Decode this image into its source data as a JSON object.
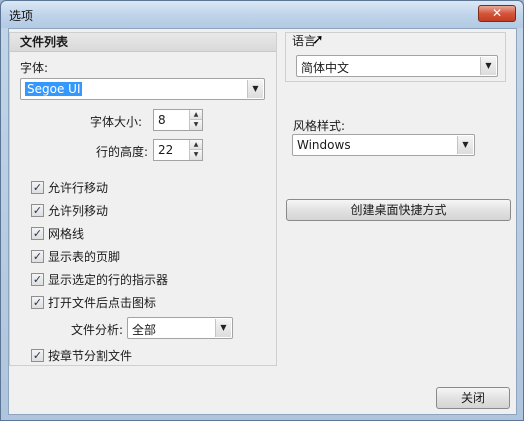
{
  "window": {
    "title": "选项",
    "close_glyph": "✕"
  },
  "file_list": {
    "header": "文件列表",
    "font_label": "字体:",
    "font_value": "Segoe UI",
    "font_size_label": "字体大小:",
    "font_size_value": "8",
    "row_height_label": "行的高度:",
    "row_height_value": "22",
    "checkboxes": [
      {
        "label": "允许行移动",
        "checked": true
      },
      {
        "label": "允许列移动",
        "checked": true
      },
      {
        "label": "网格线",
        "checked": true
      },
      {
        "label": "显示表的页脚",
        "checked": true
      },
      {
        "label": "显示选定的行的指示器",
        "checked": true
      },
      {
        "label": "打开文件后点击图标",
        "checked": true
      }
    ],
    "analysis_label": "文件分析:",
    "analysis_value": "全部",
    "split_chapters": {
      "label": "按章节分割文件",
      "checked": true
    }
  },
  "language": {
    "label": "语言",
    "value": "简体中文"
  },
  "style": {
    "label": "风格样式:",
    "value": "Windows"
  },
  "create_shortcut_label": "创建桌面快捷方式",
  "close_label": "关闭",
  "icons": {
    "dropdown": "▼",
    "spin_up": "▲",
    "spin_down": "▼",
    "check": "✓"
  }
}
